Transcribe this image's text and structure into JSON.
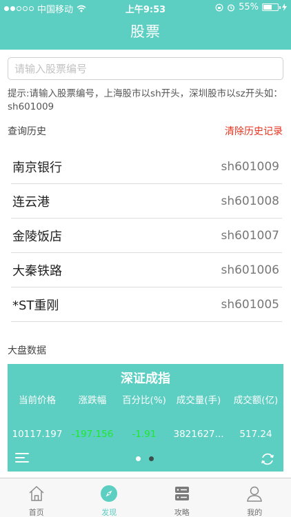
{
  "status_bar": {
    "carrier": "中国移动",
    "time": "上午9:53",
    "battery": "55%",
    "battery_level": 0.55
  },
  "header": {
    "title": "股票"
  },
  "search": {
    "placeholder": "请输入股票编号",
    "value": ""
  },
  "hint": "提示:请输入股票编号，上海股市以sh开头，深圳股市以sz开头如：sh601009",
  "history": {
    "label": "查询历史",
    "clear_label": "清除历史记录",
    "items": [
      {
        "name": "南京银行",
        "code": "sh601009"
      },
      {
        "name": "连云港",
        "code": "sh601008"
      },
      {
        "name": "金陵饭店",
        "code": "sh601007"
      },
      {
        "name": "大秦铁路",
        "code": "sh601006"
      },
      {
        "name": "*ST重刚",
        "code": "sh601005"
      }
    ]
  },
  "market": {
    "label": "大盘数据",
    "index_name": "深证成指",
    "headers": [
      "当前价格",
      "涨跌幅",
      "百分比(%)",
      "成交量(手)",
      "成交额(亿)"
    ],
    "values": [
      "10117.197",
      "-197.156",
      "-1.91",
      "3821627...",
      "517.24"
    ],
    "page_count": 2,
    "active_page": 1
  },
  "colors": {
    "accent": "#5ccfc2",
    "negative": "#1ee82e",
    "alert": "#e8321d"
  },
  "tabbar": {
    "items": [
      {
        "label": "首页",
        "icon": "home-icon"
      },
      {
        "label": "发现",
        "icon": "compass-icon"
      },
      {
        "label": "攻略",
        "icon": "server-icon"
      },
      {
        "label": "我的",
        "icon": "user-icon"
      }
    ],
    "active": 1
  }
}
